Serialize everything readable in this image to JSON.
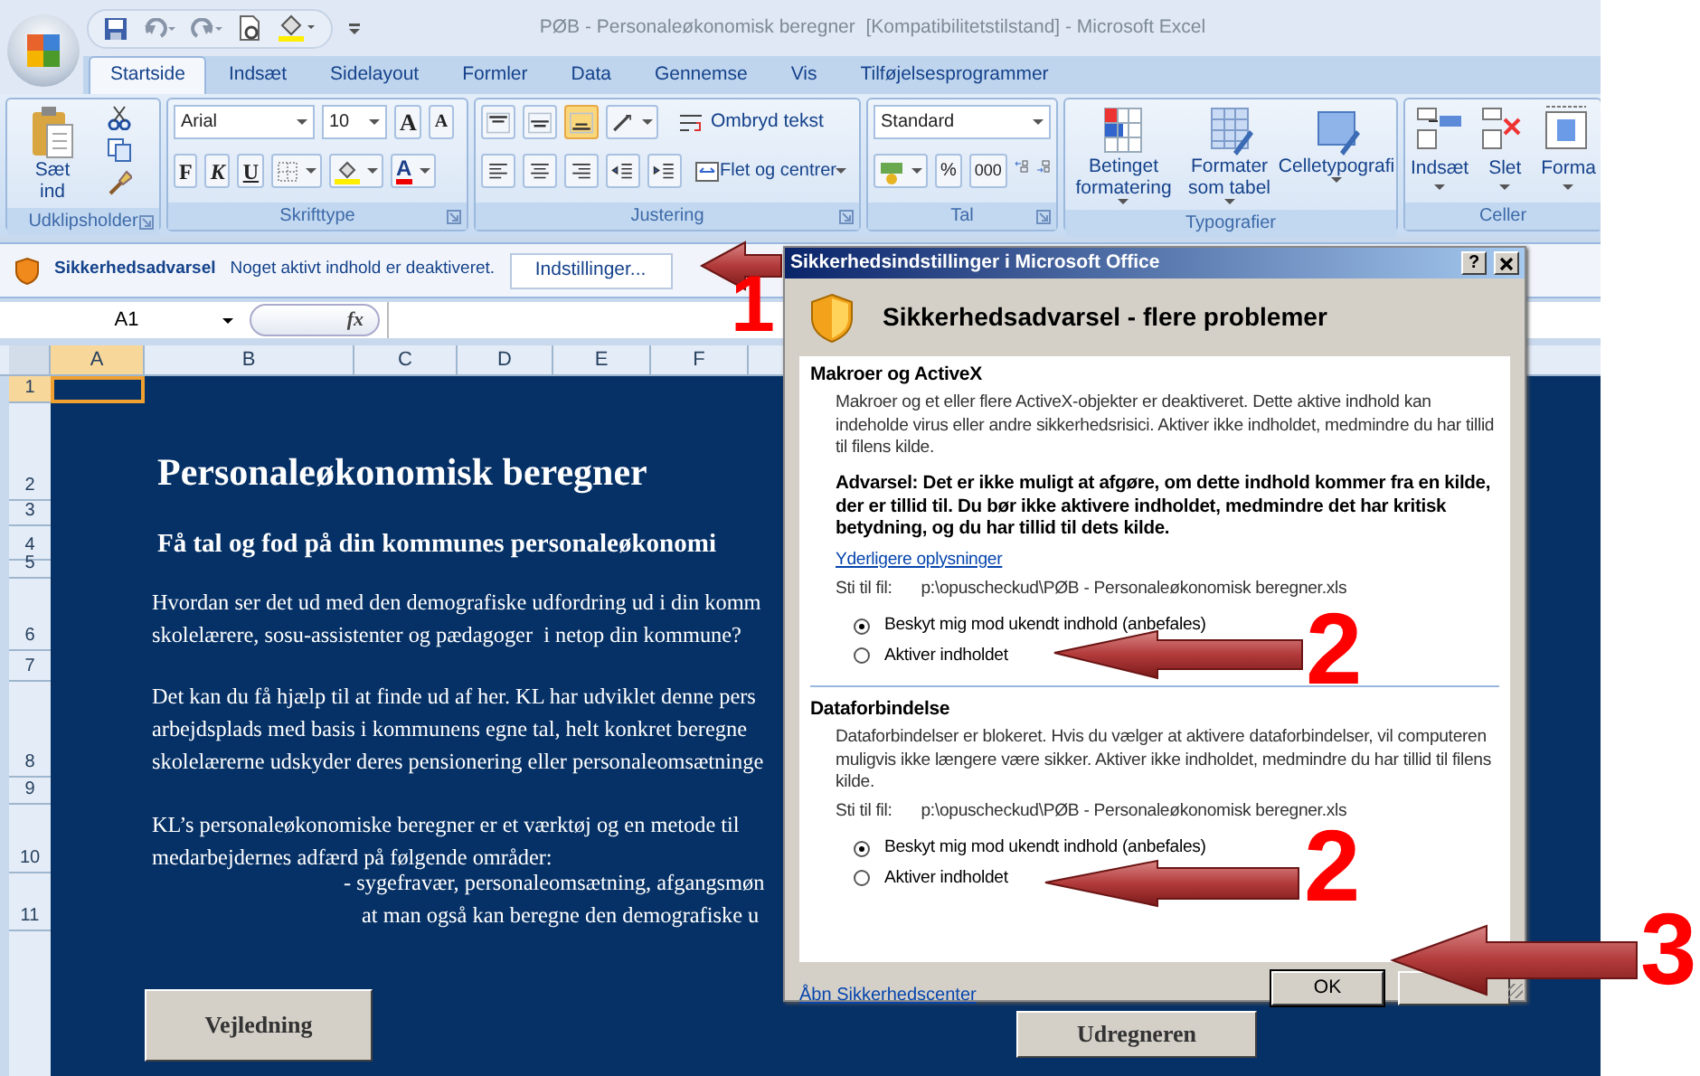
{
  "window": {
    "title": "PØB - Personaleøkonomisk beregner  [Kompatibilitetstilstand] - Microsoft Excel"
  },
  "tabs": [
    {
      "label": "Startside",
      "selected": true
    },
    {
      "label": "Indsæt",
      "selected": false
    },
    {
      "label": "Sidelayout",
      "selected": false
    },
    {
      "label": "Formler",
      "selected": false
    },
    {
      "label": "Data",
      "selected": false
    },
    {
      "label": "Gennemse",
      "selected": false
    },
    {
      "label": "Vis",
      "selected": false
    },
    {
      "label": "Tilføjelsesprogrammer",
      "selected": false
    }
  ],
  "ribbon": {
    "clipboard": {
      "paste_label": "Sæt ind",
      "group_label": "Udklipsholder"
    },
    "font": {
      "font_name": "Arial",
      "font_size": "10",
      "grow_font": "A",
      "shrink_font": "A",
      "bold": "F",
      "italic": "K",
      "underline": "U",
      "font_color": "A",
      "group_label": "Skrifttype"
    },
    "alignment": {
      "vertical_buttons": [
        {
          "selected": false
        },
        {
          "selected": false
        },
        {
          "selected": true
        }
      ],
      "wrap_text": "Ombryd tekst",
      "merge_center": "Flet og centrer",
      "group_label": "Justering"
    },
    "number": {
      "format": "Standard",
      "percent": "%",
      "thousands": "000",
      "group_label": "Tal"
    },
    "styles": {
      "buttons": [
        "Betinget formatering",
        "Formater som tabel",
        "Celletypografi"
      ],
      "group_label": "Typografier"
    },
    "cells": {
      "buttons": [
        "Indsæt",
        "Slet",
        "Forma"
      ],
      "group_label": "Celler"
    }
  },
  "security_bar": {
    "title": "Sikkerhedsadvarsel",
    "message": "Noget aktivt indhold er deaktiveret.",
    "button": "Indstillinger..."
  },
  "formula_bar": {
    "name_box": "A1",
    "fx": "fx"
  },
  "sheet": {
    "columns": [
      {
        "label": "A",
        "selected": true
      },
      {
        "label": "B",
        "selected": false
      },
      {
        "label": "C",
        "selected": false
      },
      {
        "label": "D",
        "selected": false
      },
      {
        "label": "E",
        "selected": false
      },
      {
        "label": "F",
        "selected": false
      }
    ],
    "rows": [
      {
        "number": "1",
        "selected": true
      },
      {
        "number": "2",
        "selected": false,
        "kind": "title",
        "lines": [
          "Personaleøkonomisk beregner"
        ]
      },
      {
        "number": "3",
        "selected": false
      },
      {
        "number": "4",
        "selected": false,
        "kind": "subtitle",
        "lines": [
          "Få tal og fod på din kommunes personaleøkonomi"
        ]
      },
      {
        "number": "5",
        "selected": false
      },
      {
        "number": "6",
        "selected": false,
        "kind": "body",
        "lines": [
          "Hvordan ser det ud med den demografiske udfordring ud i din komm",
          "skolelærere, sosu-assistenter og pædagoger  i netop din kommune?"
        ]
      },
      {
        "number": "7",
        "selected": false
      },
      {
        "number": "8",
        "selected": false,
        "kind": "body",
        "lines": [
          "Det kan du få hjælp til at finde ud af her. KL har udviklet denne pers",
          "arbejdsplads med basis i kommunens egne tal, helt konkret beregne",
          "skolelærerne udskyder deres pensionering eller personaleomsætninge"
        ]
      },
      {
        "number": "9",
        "selected": false
      },
      {
        "number": "10",
        "selected": false,
        "kind": "body",
        "lines": [
          "KL’s personaleøkonomiske beregner er et værktøj og en metode til",
          "medarbejdernes adfærd på følgende områder:"
        ]
      },
      {
        "number": "11",
        "selected": false,
        "kind": "bullet",
        "lines": [
          "- sygefravær, personaleomsætning, afgangsmøn",
          "at man også kan beregne den demografiske u"
        ]
      }
    ],
    "buttons": [
      "Vejledning",
      "Udregneren"
    ]
  },
  "dialog": {
    "title": "Sikkerhedsindstillinger i Microsoft Office",
    "help": "?",
    "heading": "Sikkerhedsadvarsel - flere problemer",
    "sections": [
      {
        "heading": "Makroer og ActiveX",
        "text": "Makroer og et eller flere ActiveX-objekter er deaktiveret. Dette aktive indhold kan indeholde virus eller andre sikkerhedsrisici. Aktiver ikke indholdet, medmindre du har tillid til filens kilde.",
        "warning": "Advarsel: Det er ikke muligt at afgøre, om dette indhold kommer fra en kilde, der er tillid til. Du bør ikke aktivere indholdet, medmindre det har kritisk betydning, og du har tillid til dets kilde.",
        "link": "Yderligere oplysninger",
        "path_label": "Sti til fil:",
        "path": "p:\\opuscheckud\\PØB - Personaleøkonomisk beregner.xls",
        "options": [
          {
            "label": "Beskyt mig mod ukendt indhold (anbefales)",
            "selected": true
          },
          {
            "label": "Aktiver indholdet",
            "selected": false
          }
        ]
      },
      {
        "heading": "Dataforbindelse",
        "text": "Dataforbindelser er blokeret. Hvis du vælger at aktivere dataforbindelser, vil computeren muligvis ikke længere være sikker. Aktiver ikke indholdet, medmindre du har tillid til filens kilde.",
        "path_label": "Sti til fil:",
        "path": "p:\\opuscheckud\\PØB - Personaleøkonomisk beregner.xls",
        "options": [
          {
            "label": "Beskyt mig mod ukendt indhold (anbefales)",
            "selected": true
          },
          {
            "label": "Aktiver indholdet",
            "selected": false
          }
        ]
      }
    ],
    "footer_link": "Åbn Sikkerhedscenter",
    "ok": "OK"
  },
  "annotations": [
    {
      "number": "1"
    },
    {
      "number": "2"
    },
    {
      "number": "2"
    },
    {
      "number": "3"
    }
  ]
}
